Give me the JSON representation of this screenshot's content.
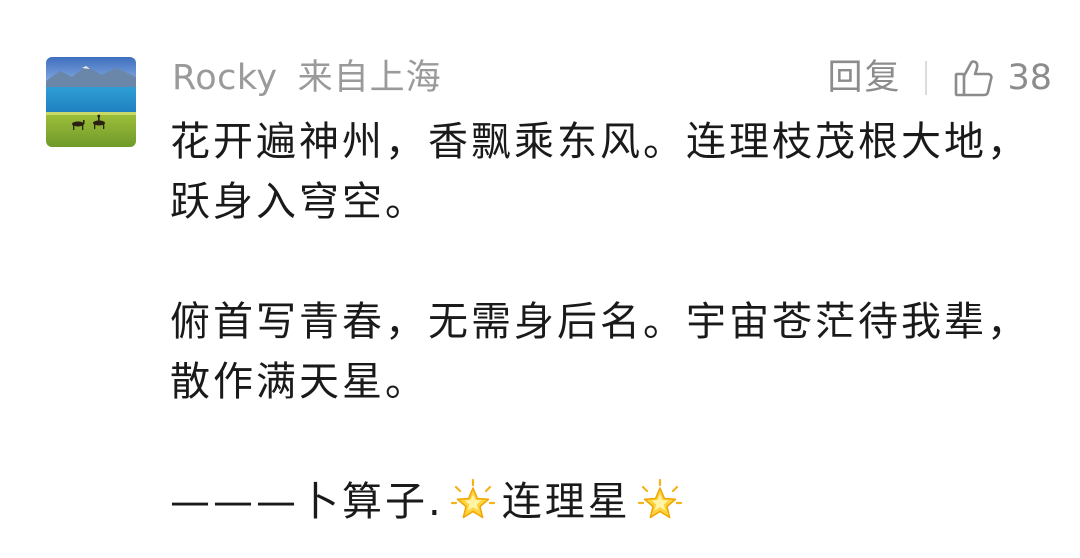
{
  "comment": {
    "avatar": {
      "icon": "landscape-avatar"
    },
    "username": "Rocky",
    "location": "来自上海",
    "reply_label": "回复",
    "like_count": "38",
    "paragraphs": [
      "花开遍神州，香飘乘东风。连理枝茂根大地，跃身入穹空。",
      "俯首写青春，无需身后名。宇宙苍茫待我辈，散作满天星。"
    ],
    "signature": {
      "prefix": "———卜算子.",
      "title": "连理星",
      "emoji": "glowing-star"
    }
  }
}
